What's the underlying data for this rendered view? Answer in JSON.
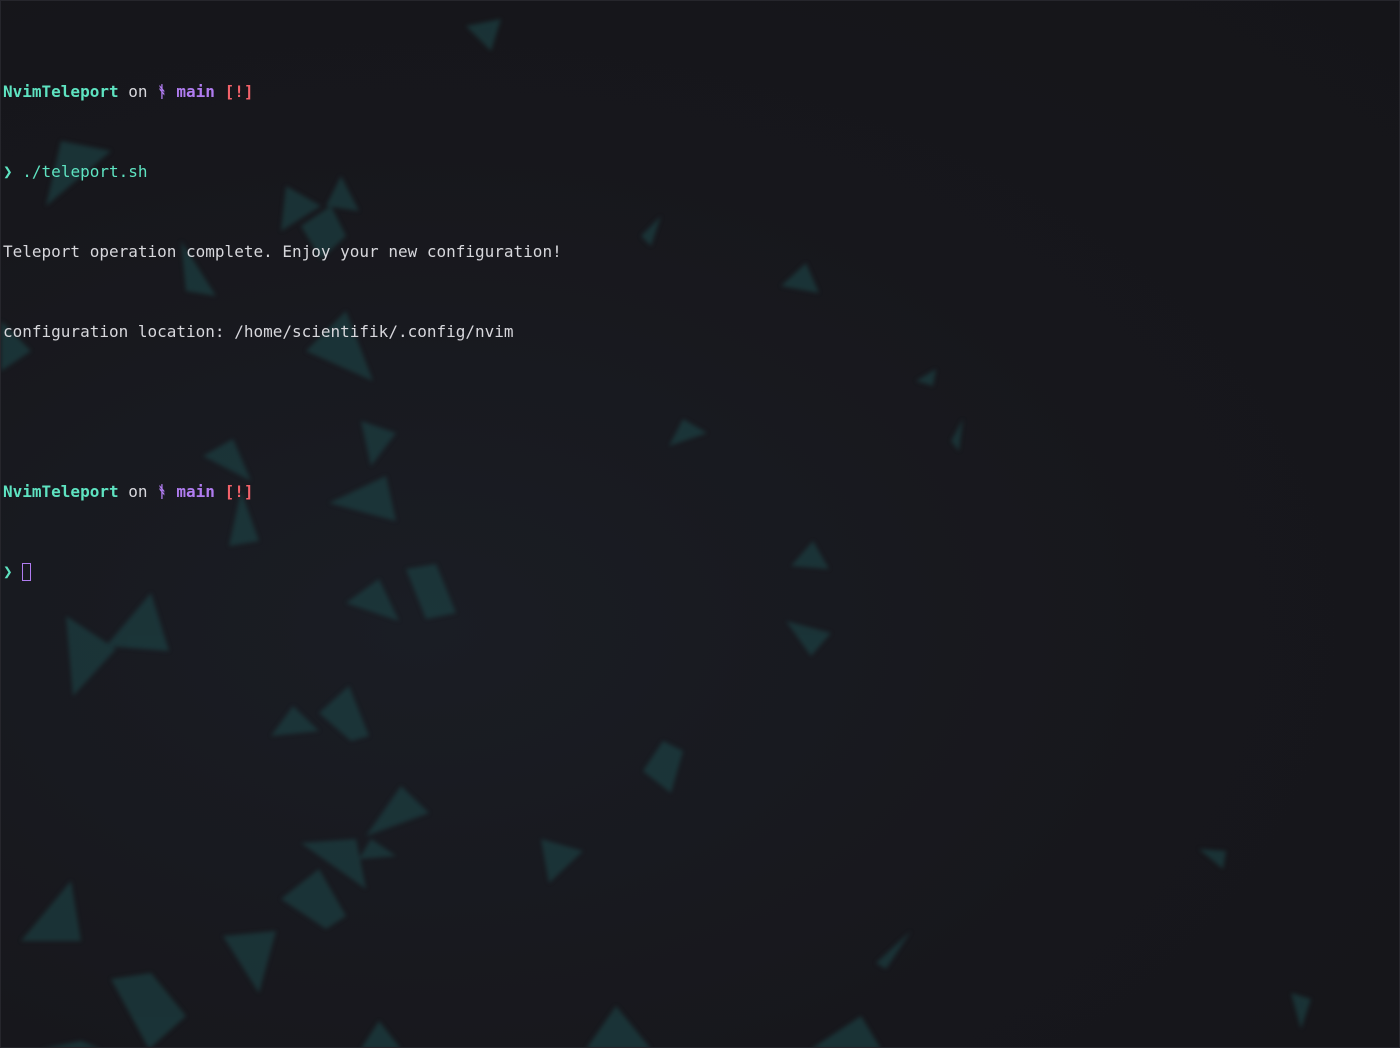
{
  "colors": {
    "background": "#16161b",
    "directory": "#5ee3c1",
    "branch": "#b07cf0",
    "git_status": "#f2626a",
    "prompt_arrow": "#5ee3c1",
    "text": "#d7d7dc"
  },
  "terminal": {
    "prompt_1": {
      "directory": "NvimTeleport",
      "on": "on",
      "branch_icon": "",
      "branch_icon_name": "git-branch-icon",
      "branch": "main",
      "git_status": "[!]"
    },
    "command_line": {
      "arrow": "❯",
      "command": "./teleport.sh"
    },
    "output": [
      "Teleport operation complete. Enjoy your new configuration!",
      "configuration location: /home/scientifik/.config/nvim"
    ],
    "prompt_2": {
      "directory": "NvimTeleport",
      "on": "on",
      "branch_icon": "",
      "branch_icon_name": "git-branch-icon",
      "branch": "main",
      "git_status": "[!]"
    },
    "input_line": {
      "arrow": "❯",
      "value": ""
    }
  }
}
